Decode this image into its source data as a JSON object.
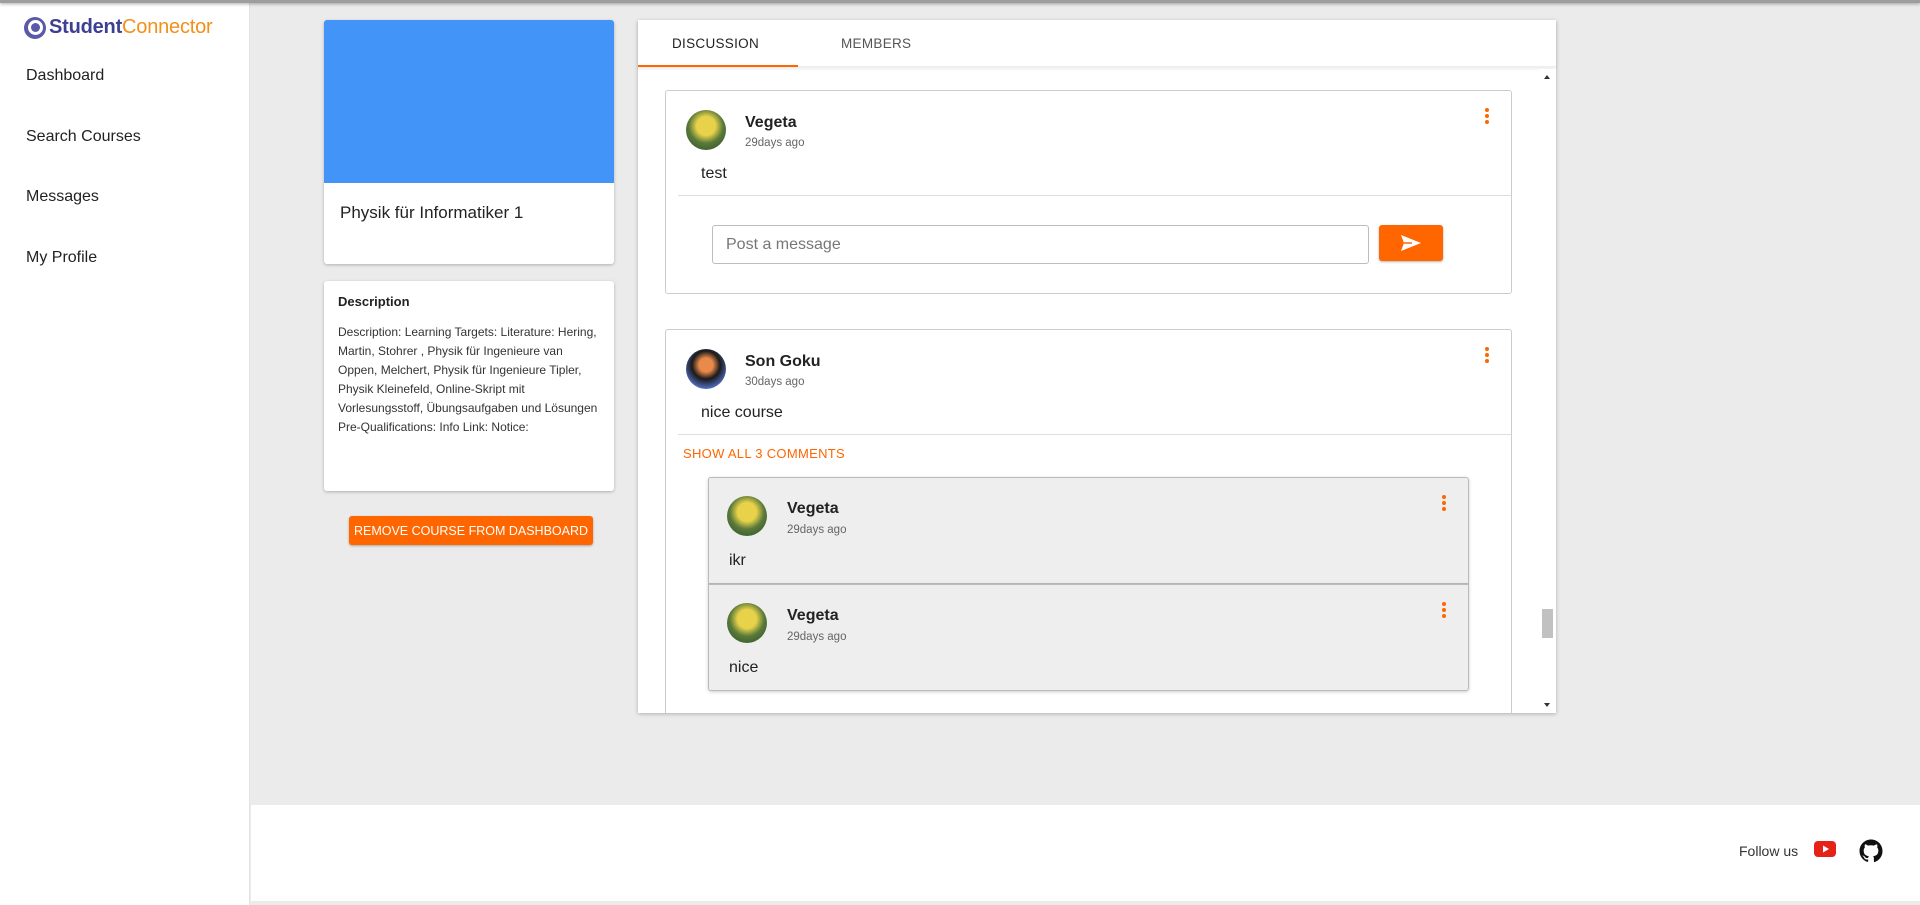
{
  "app": {
    "logo_primary": "Student",
    "logo_secondary": "Connector",
    "brand_colors": {
      "primary": "#3d3f93",
      "secondary": "#f29018",
      "accent": "#ff6600",
      "banner": "#4394f9"
    }
  },
  "sidebar": {
    "items": [
      {
        "label": "Dashboard"
      },
      {
        "label": "Search Courses"
      },
      {
        "label": "Messages"
      },
      {
        "label": "My Profile"
      }
    ]
  },
  "course": {
    "title": "Physik für Informatiker 1",
    "description_heading": "Description",
    "description": "Description: Learning Targets: Literature: Hering, Martin, Stohrer , Physik für Ingenieure van Oppen, Melchert, Physik für Ingenieure Tipler, Physik Kleinefeld, Online-Skript mit Vorlesungsstoff, Übungsaufgaben und Lösungen Pre-Qualifications: Info Link: Notice:",
    "remove_label": "REMOVE COURSE FROM DASHBOARD"
  },
  "tabs": [
    {
      "label": "DISCUSSION",
      "active": true
    },
    {
      "label": "MEMBERS",
      "active": false
    }
  ],
  "composer": {
    "placeholder": "Post a message",
    "send_icon": "send-icon"
  },
  "posts": [
    {
      "author": "Vegeta",
      "time": "29days ago",
      "text": "test",
      "avatar": "vegeta-avatar"
    },
    {
      "author": "Son Goku",
      "time": "30days ago",
      "text": "nice course",
      "avatar": "goku-avatar",
      "show_all_label": "SHOW ALL 3 COMMENTS",
      "comments": [
        {
          "author": "Vegeta",
          "time": "29days ago",
          "text": "ikr"
        },
        {
          "author": "Vegeta",
          "time": "29days ago",
          "text": "nice"
        }
      ]
    }
  ],
  "footer": {
    "follow_label": "Follow us",
    "icons": [
      "youtube-icon",
      "github-icon"
    ]
  }
}
